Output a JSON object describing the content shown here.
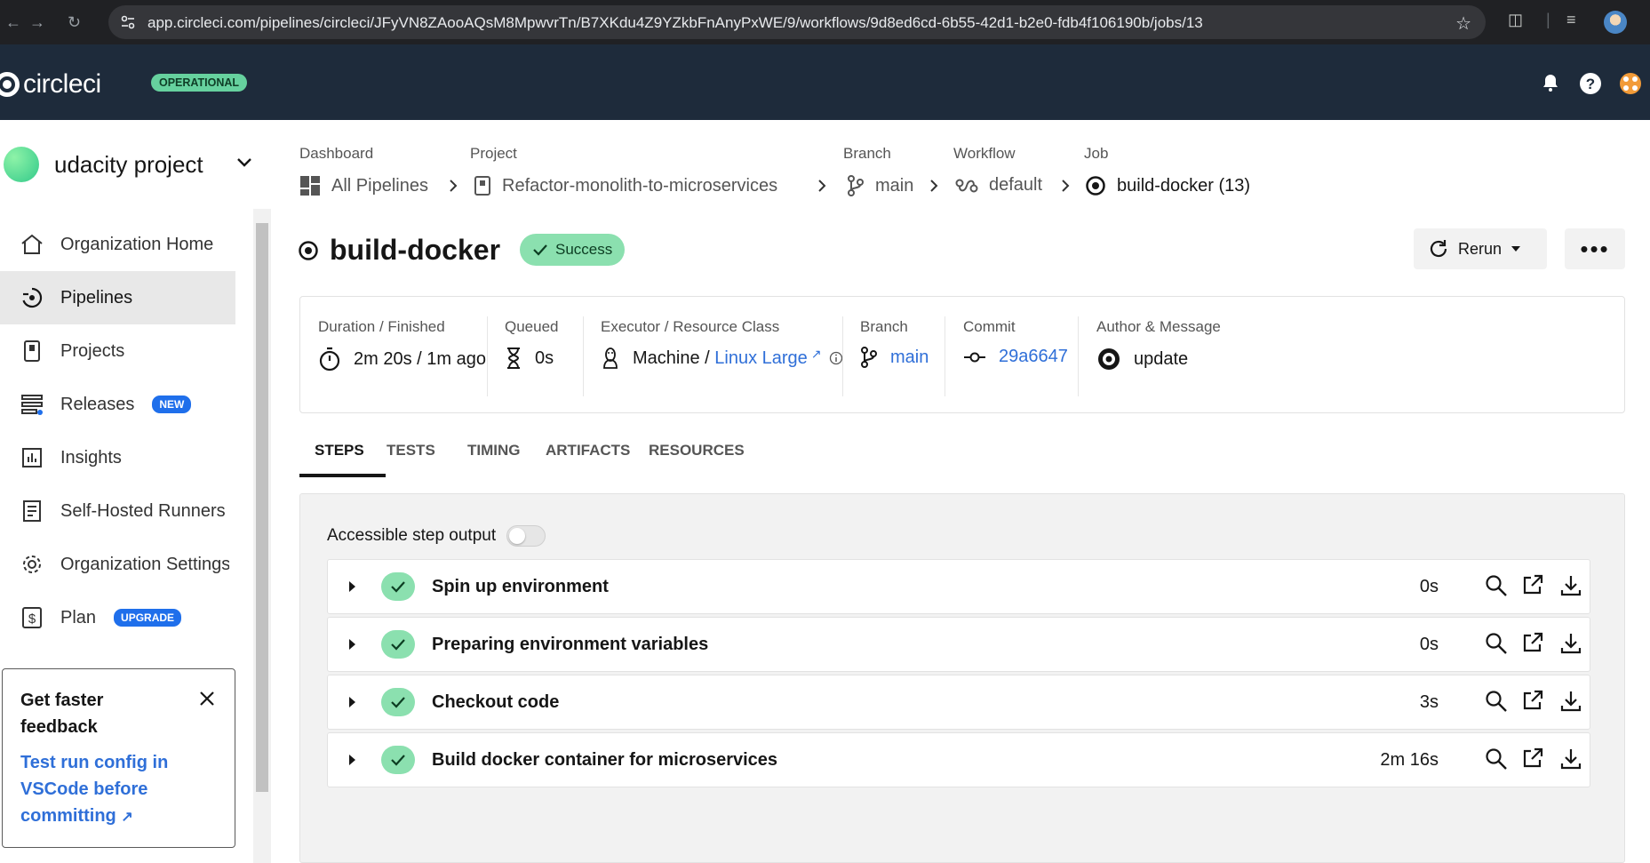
{
  "browser": {
    "url": "app.circleci.com/pipelines/circleci/JFyVN8ZAooAQsM8MpwvrTn/B7XKdu4Z9YZkbFnAnyPxWE/9/workflows/9d8ed6cd-6b55-42d1-b2e0-fdb4f106190b/jobs/13"
  },
  "header": {
    "logo_text": "circleci",
    "status": "OPERATIONAL"
  },
  "sidebar": {
    "org_name": "udacity project",
    "items": [
      {
        "label": "Organization Home",
        "icon": "home-icon"
      },
      {
        "label": "Pipelines",
        "icon": "pipelines-icon",
        "active": true
      },
      {
        "label": "Projects",
        "icon": "projects-icon"
      },
      {
        "label": "Releases",
        "icon": "releases-icon",
        "badge": "NEW"
      },
      {
        "label": "Insights",
        "icon": "insights-icon"
      },
      {
        "label": "Self-Hosted Runners",
        "icon": "runners-icon"
      },
      {
        "label": "Organization Settings",
        "icon": "gear-icon"
      },
      {
        "label": "Plan",
        "icon": "dollar-icon",
        "badge": "UPGRADE"
      }
    ],
    "promo": {
      "title": "Get faster feedback",
      "link": "Test run config in VSCode before committing"
    }
  },
  "breadcrumbs": {
    "labels": {
      "dashboard": "Dashboard",
      "project": "Project",
      "branch": "Branch",
      "workflow": "Workflow",
      "job": "Job"
    },
    "values": {
      "dashboard": "All Pipelines",
      "project": "Refactor-monolith-to-microservices",
      "branch": "main",
      "workflow": "default",
      "job": "build-docker (13)"
    }
  },
  "job": {
    "name": "build-docker",
    "status": "Success",
    "rerun_label": "Rerun",
    "more_label": "•••"
  },
  "summary": {
    "duration": {
      "label": "Duration / Finished",
      "value": "2m 20s / 1m ago"
    },
    "queued": {
      "label": "Queued",
      "value": "0s"
    },
    "executor": {
      "label": "Executor / Resource Class",
      "machine": "Machine",
      "slash": " / ",
      "resource": "Linux Large"
    },
    "branch": {
      "label": "Branch",
      "value": "main"
    },
    "commit": {
      "label": "Commit",
      "value": "29a6647"
    },
    "author": {
      "label": "Author & Message",
      "value": "update"
    }
  },
  "tabs": [
    "STEPS",
    "TESTS",
    "TIMING",
    "ARTIFACTS",
    "RESOURCES"
  ],
  "steps_panel": {
    "accessible_label": "Accessible step output",
    "steps": [
      {
        "name": "Spin up environment",
        "duration": "0s"
      },
      {
        "name": "Preparing environment variables",
        "duration": "0s"
      },
      {
        "name": "Checkout code",
        "duration": "3s"
      },
      {
        "name": "Build docker container for microservices",
        "duration": "2m 16s"
      }
    ]
  },
  "colors": {
    "header_bg": "#1e2b3b",
    "success_green": "#8be0af",
    "link_blue": "#2f6fd8",
    "badge_blue": "#1f6feb"
  }
}
